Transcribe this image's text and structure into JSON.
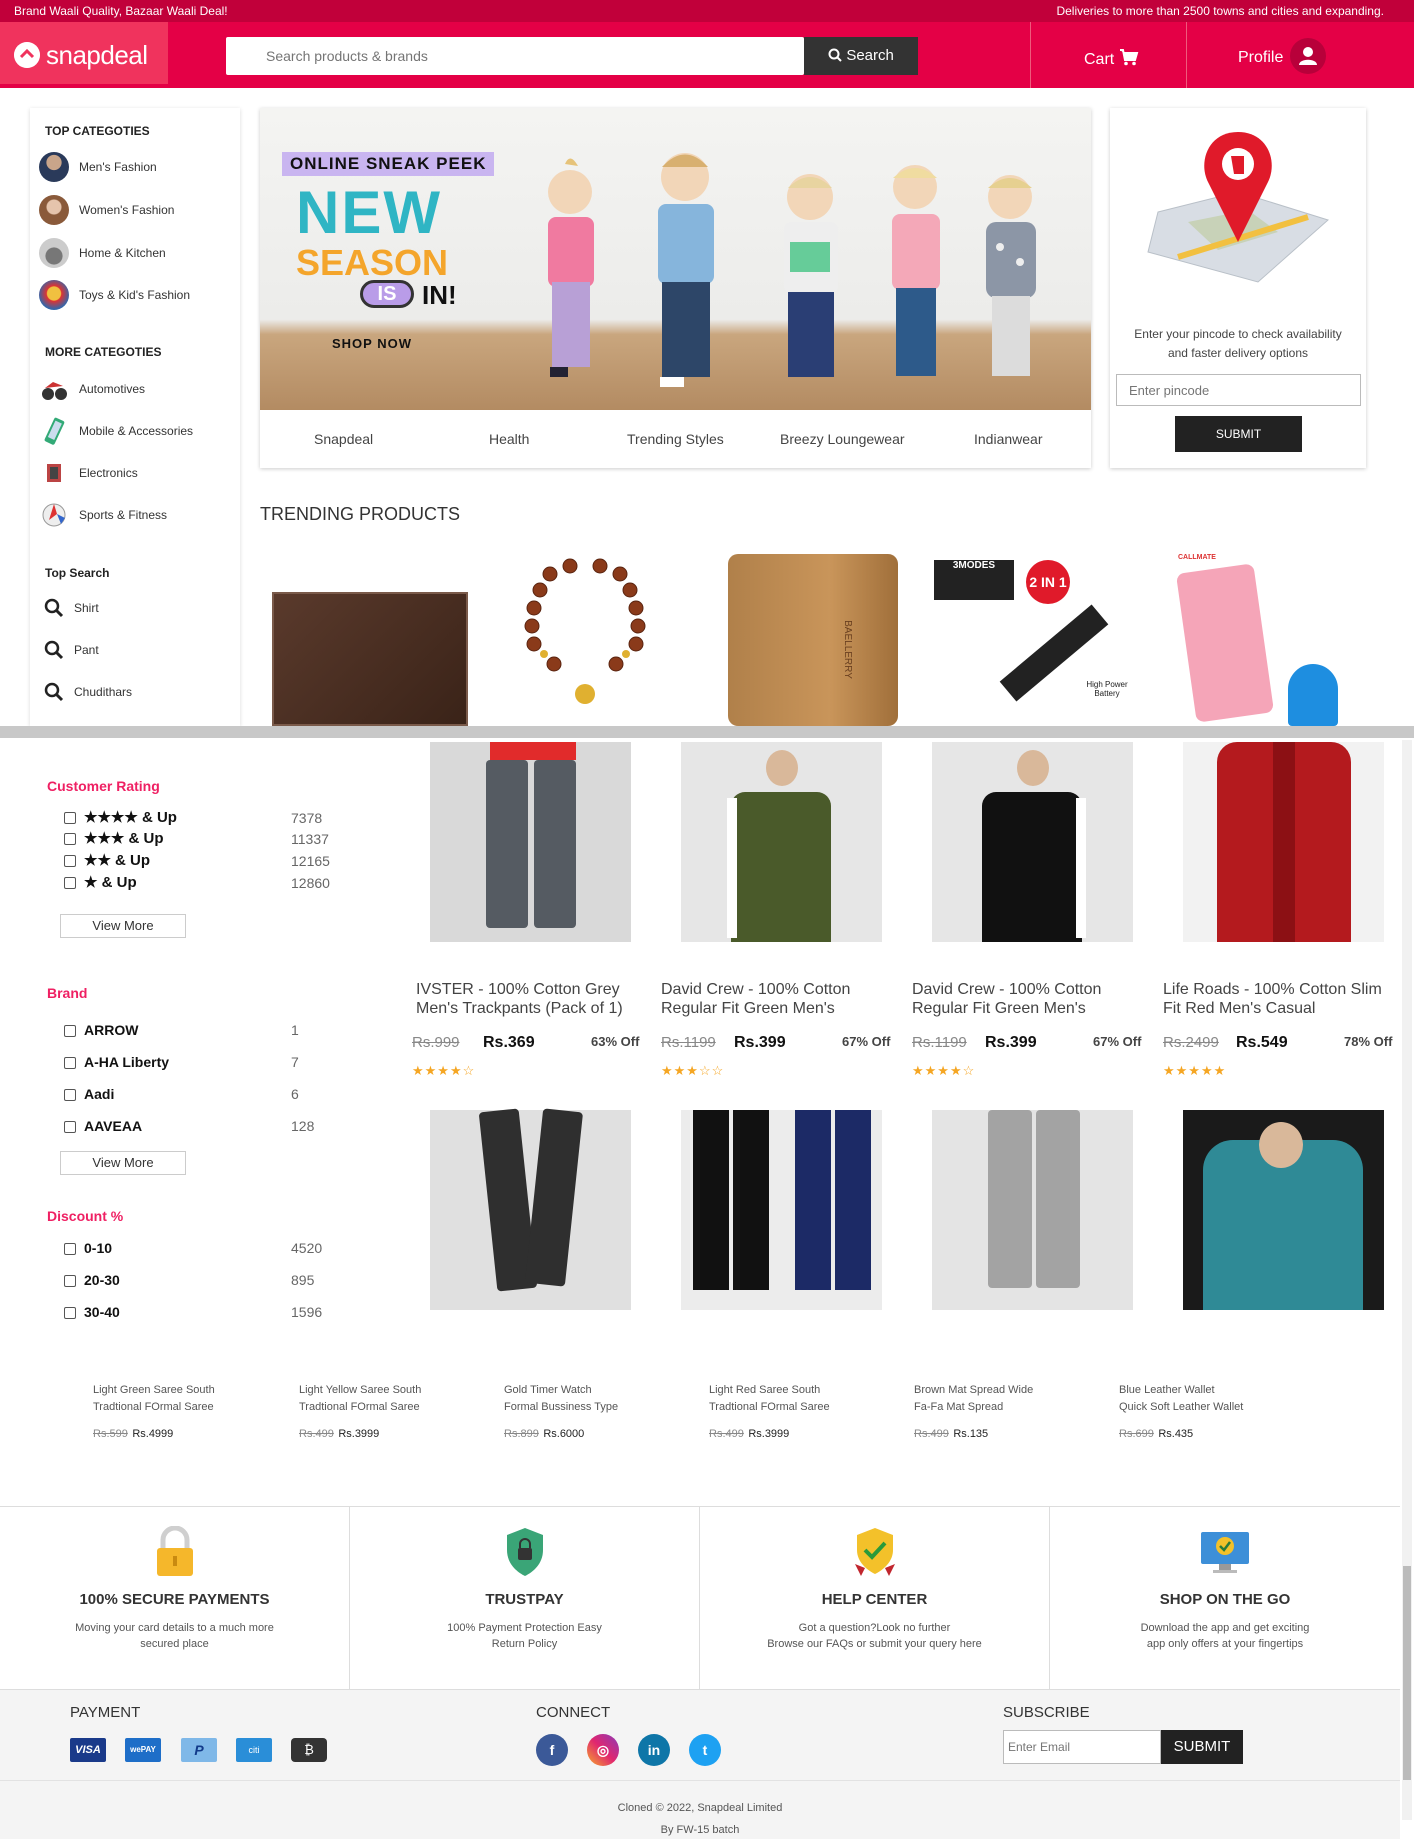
{
  "topstrip": {
    "left": "Brand Waali Quality, Bazaar Waali Deal!",
    "right": "Deliveries to more than 2500 towns and cities and expanding."
  },
  "header": {
    "logo": "snapdeal",
    "search_placeholder": "Search products & brands",
    "search_button": "Search",
    "cart": "Cart",
    "profile": "Profile"
  },
  "sidebar": {
    "top_heading": "TOP CATEGOTIES",
    "top_items": [
      "Men's Fashion",
      "Women's Fashion",
      "Home & Kitchen",
      "Toys & Kid's Fashion"
    ],
    "more_heading": "MORE CATEGOTIES",
    "more_items": [
      "Automotives",
      "Mobile & Accessories",
      "Electronics",
      "Sports & Fitness"
    ],
    "search_heading": "Top Search",
    "search_items": [
      "Shirt",
      "Pant",
      "Chudithars"
    ]
  },
  "banner": {
    "line1": "ONLINE SNEAK PEEK",
    "line2": "NEW",
    "line3": "SEASON",
    "line4": "IS",
    "line5": "IN!",
    "cta": "SHOP NOW",
    "tabs": [
      "Snapdeal",
      "Health",
      "Trending Styles",
      "Breezy Loungewear",
      "Indianwear"
    ]
  },
  "pincode": {
    "message": "Enter your pincode to check availability and faster delivery options",
    "placeholder": "Enter pincode",
    "submit": "SUBMIT"
  },
  "trending": {
    "title": "TRENDING PRODUCTS",
    "tile_labels": [
      "3MODES",
      "2 IN 1",
      "High Power Battery",
      "CALLMATE",
      "BAELLERRY"
    ]
  },
  "filters": {
    "rating": {
      "heading": "Customer Rating",
      "items": [
        {
          "label": "★★★★ & Up",
          "count": "7378"
        },
        {
          "label": "★★★ & Up",
          "count": "11337"
        },
        {
          "label": "★★ & Up",
          "count": "12165"
        },
        {
          "label": "★ & Up",
          "count": "12860"
        }
      ],
      "more": "View More"
    },
    "brand": {
      "heading": "Brand",
      "items": [
        {
          "label": "ARROW",
          "count": "1"
        },
        {
          "label": "A-HA Liberty",
          "count": "7"
        },
        {
          "label": "Aadi",
          "count": "6"
        },
        {
          "label": "AAVEAA",
          "count": "128"
        }
      ],
      "more": "View More"
    },
    "discount": {
      "heading": "Discount %",
      "items": [
        {
          "label": "0-10",
          "count": "4520"
        },
        {
          "label": "20-30",
          "count": "895"
        },
        {
          "label": "30-40",
          "count": "1596"
        }
      ]
    }
  },
  "products": [
    {
      "title1": "IVSTER - 100% Cotton Grey",
      "title2": "Men's Trackpants (Pack of 1)",
      "mrp": "Rs.999",
      "price": "Rs.369",
      "off": "63% Off",
      "stars": "★★★★☆"
    },
    {
      "title1": "David Crew - 100% Cotton",
      "title2": "Regular Fit Green Men's",
      "mrp": "Rs.1199",
      "price": "Rs.399",
      "off": "67% Off",
      "stars": "★★★☆☆"
    },
    {
      "title1": "David Crew - 100% Cotton",
      "title2": "Regular Fit Green Men's",
      "mrp": "Rs.1199",
      "price": "Rs.399",
      "off": "67% Off",
      "stars": "★★★★☆"
    },
    {
      "title1": "Life Roads - 100% Cotton Slim",
      "title2": "Fit Red Men's Casual",
      "mrp": "Rs.2499",
      "price": "Rs.549",
      "off": "78% Off",
      "stars": "★★★★★"
    }
  ],
  "recos": [
    {
      "t1": "Light Green Saree South",
      "t2": "Tradtional FOrmal Saree",
      "mrp": "Rs.599",
      "price": "Rs.4999"
    },
    {
      "t1": "Light Yellow Saree South",
      "t2": "Tradtional FOrmal Saree",
      "mrp": "Rs.499",
      "price": "Rs.3999"
    },
    {
      "t1": "Gold Timer Watch",
      "t2": "Formal Bussiness Type",
      "mrp": "Rs.899",
      "price": "Rs.6000"
    },
    {
      "t1": "Light Red Saree South",
      "t2": "Tradtional FOrmal Saree",
      "mrp": "Rs.499",
      "price": "Rs.3999"
    },
    {
      "t1": "Brown Mat Spread Wide",
      "t2": "Fa-Fa Mat Spread",
      "mrp": "Rs.499",
      "price": "Rs.135"
    },
    {
      "t1": "Blue Leather Wallet",
      "t2": "Quick Soft Leather Wallet",
      "mrp": "Rs.699",
      "price": "Rs.435"
    }
  ],
  "features": [
    {
      "title": "100% SECURE PAYMENTS",
      "d1": "Moving your card details to a much more",
      "d2": "secured place"
    },
    {
      "title": "TRUSTPAY",
      "d1": "100% Payment Protection Easy",
      "d2": "Return Policy"
    },
    {
      "title": "HELP CENTER",
      "d1": "Got a question?Look no further",
      "d2": "Browse our FAQs or submit your query here"
    },
    {
      "title": "SHOP ON THE GO",
      "d1": "Download the app and get exciting",
      "d2": "app only offers at your fingertips"
    }
  ],
  "footer": {
    "payment": "PAYMENT",
    "connect": "CONNECT",
    "subscribe": "SUBSCRIBE",
    "pay_labels": [
      "VISA",
      "wePAY",
      "P",
      "citi",
      "₿"
    ],
    "social_labels": [
      "f",
      "◎",
      "in",
      "t"
    ],
    "email_placeholder": "Enter Email",
    "submit": "SUBMIT",
    "copy1": "Cloned © 2022, Snapdeal Limited",
    "copy2": "By FW-15 batch"
  },
  "colors": {
    "brand": "#e40046",
    "brand_dark": "#c1003a",
    "filter_heading": "#ef2063",
    "star": "#f5a623"
  }
}
